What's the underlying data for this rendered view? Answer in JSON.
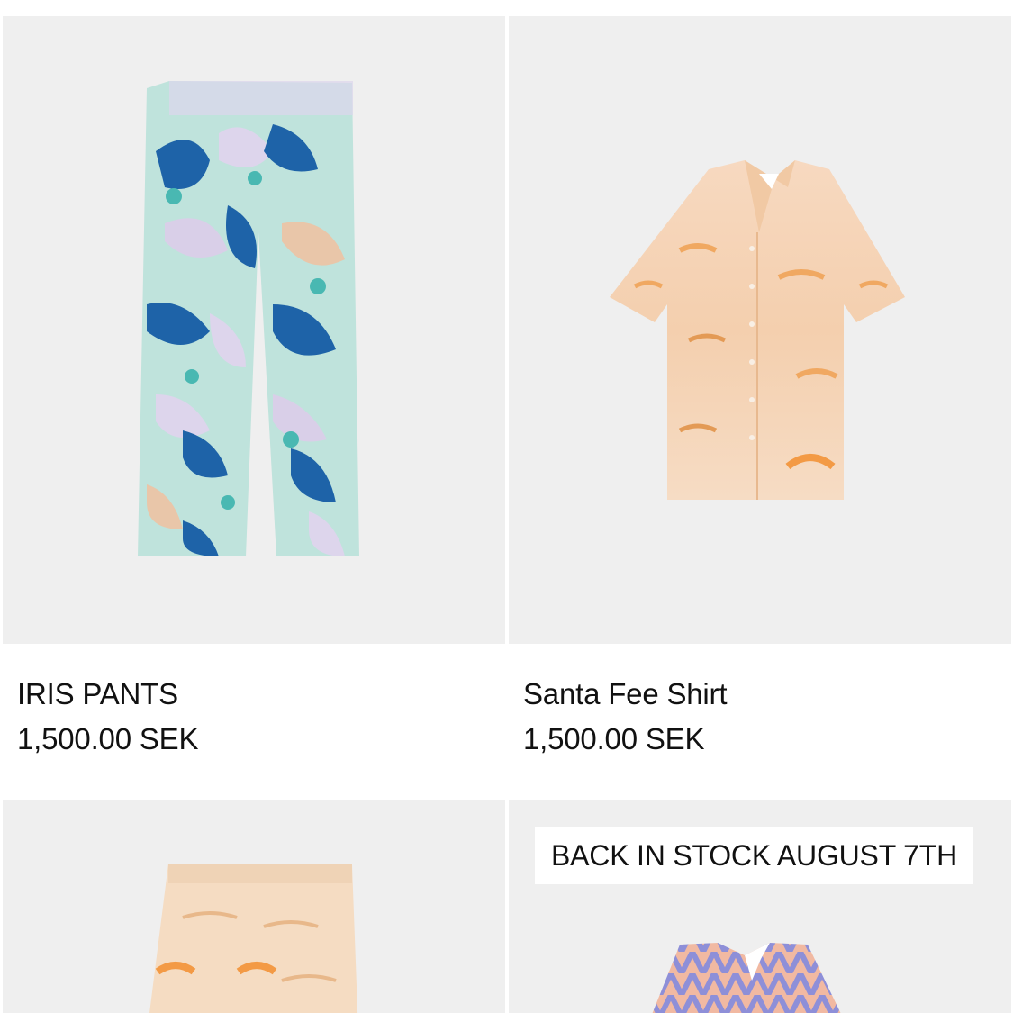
{
  "products": [
    {
      "name": "IRIS PANTS",
      "price": "1,500.00 SEK",
      "image_icon": "iris-pants-image"
    },
    {
      "name": "Santa Fee Shirt",
      "price": "1,500.00 SEK",
      "image_icon": "santa-fee-shirt-image"
    },
    {
      "name": "",
      "price": "",
      "image_icon": "shorts-image"
    },
    {
      "name": "",
      "price": "",
      "image_icon": "patterned-shirt-image",
      "badge": "BACK IN STOCK AUGUST 7TH"
    }
  ],
  "colors": {
    "card_background": "#efefef",
    "page_background": "#ffffff",
    "text": "#111111"
  }
}
